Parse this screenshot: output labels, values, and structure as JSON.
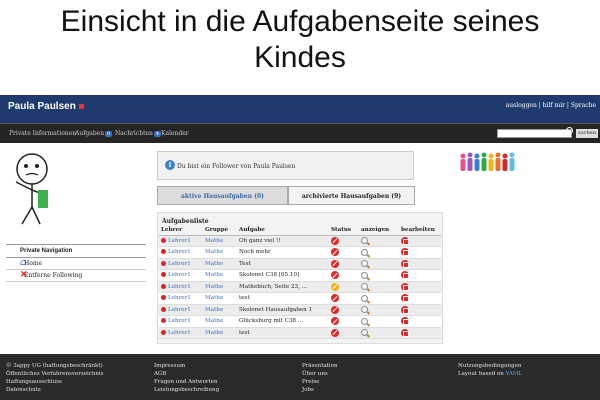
{
  "slide_title": [
    "Einsicht in die Aufgabenseite seines",
    "Kindes"
  ],
  "header": {
    "user_name": "Paula Paulsen",
    "links": [
      "ausloggen",
      "hilf mir",
      "Sprache"
    ],
    "bg_color": "#1f3b6e"
  },
  "nav": {
    "items": [
      {
        "label": "Private Informationen",
        "badge": ""
      },
      {
        "label": "Aufgaben",
        "badge": "0"
      },
      {
        "label": "Nachrichten",
        "badge": "4"
      },
      {
        "label": "Kalender",
        "badge": ""
      }
    ],
    "search_button": "suchen"
  },
  "sidebar": {
    "title": "Private Navigation",
    "items": [
      {
        "label": "Home",
        "icon": "home-icon"
      },
      {
        "label": "Entferne Following",
        "icon": "remove-icon"
      }
    ]
  },
  "info": {
    "text": "Du bist ein Follower von Paula Paulsen",
    "icon": "info-icon"
  },
  "tabs": {
    "active": "aktive Hausaufgaben (0)",
    "archived": "archivierte Hausaufgaben (9)"
  },
  "tasks": {
    "title": "Aufgabenliste",
    "columns": [
      "Lehrer",
      "Gruppe",
      "Aufgabe",
      "Status",
      "anzeigen",
      "bearbeiten"
    ],
    "rows": [
      {
        "teacher": "Lehrer1",
        "group": "Mathe",
        "task": "Oh ganz viel !!",
        "status": "red"
      },
      {
        "teacher": "Lehrer1",
        "group": "Mathe",
        "task": "Noch mehr",
        "status": "red"
      },
      {
        "teacher": "Lehrer1",
        "group": "Mathe",
        "task": "Test",
        "status": "red"
      },
      {
        "teacher": "Lehrer1",
        "group": "Mathe",
        "task": "Skolenet C38 [05.10]",
        "status": "red"
      },
      {
        "teacher": "Lehrer1",
        "group": "Mathe",
        "task": "Mathebuch, Seite 23, ...",
        "status": "yellow"
      },
      {
        "teacher": "Lehrer1",
        "group": "Mathe",
        "task": "test",
        "status": "red"
      },
      {
        "teacher": "Lehrer1",
        "group": "Mathe",
        "task": "Skolenet Hausaufgaben 1",
        "status": "red"
      },
      {
        "teacher": "Lehrer1",
        "group": "Mathe",
        "task": "Glücksburg mit C38 ...",
        "status": "red"
      },
      {
        "teacher": "Lehrer1",
        "group": "Mathe",
        "task": "test",
        "status": "red"
      }
    ]
  },
  "footer": {
    "col1": [
      "© 3appy UG (haftungsbeschränkt)",
      "Öffentliches Verfahrensverzeichnis",
      "Haftungsausschluss",
      "Datenschutz"
    ],
    "col2": [
      "Impressum",
      "AGB",
      "Fragen und Antworten",
      "Leistungsbeschreibung"
    ],
    "col3": [
      "Präsentation",
      "Über uns",
      "Preise",
      "Jobs"
    ],
    "col4": [
      "Nutzungsbedingungen",
      "Layout based on"
    ],
    "layout_link": "YAML"
  }
}
